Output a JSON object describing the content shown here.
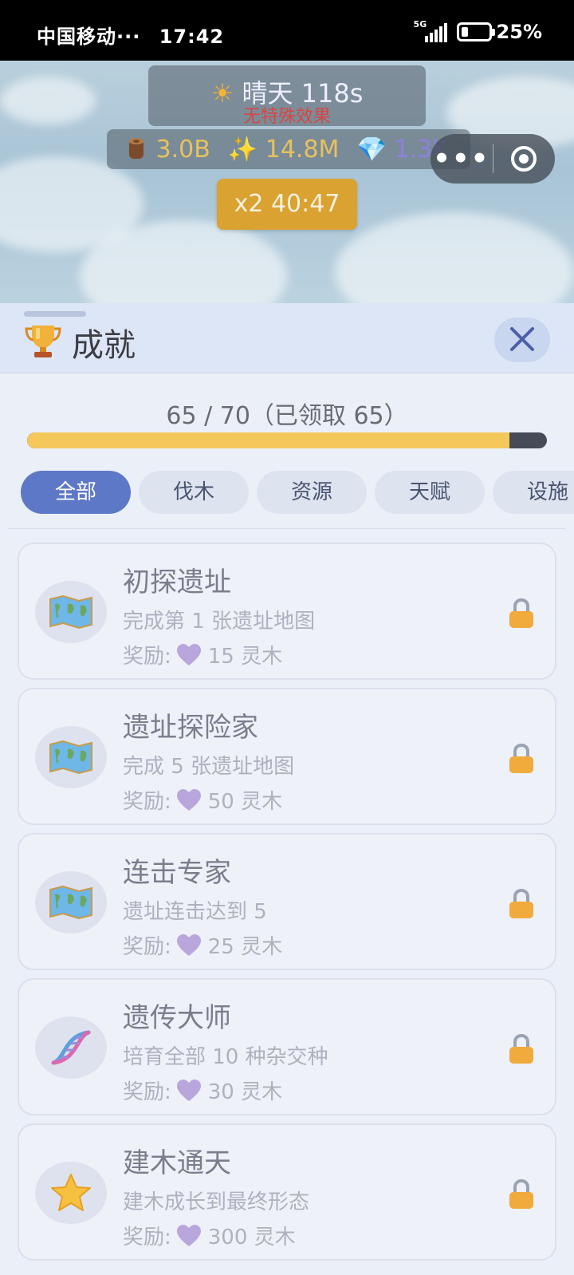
{
  "status_bar": {
    "carrier": "中国移动···",
    "time": "17:42",
    "network": "5G",
    "battery": "25%",
    "battery_level": 0.25
  },
  "game": {
    "weather_label": "晴天",
    "weather_timer": "118s",
    "weather_effect": "无特殊效果",
    "wood": "3.0B",
    "sparkle": "14.8M",
    "gems": "1.3K",
    "boost": "x2 40:47"
  },
  "panel": {
    "title": "成就",
    "progress_text": "65 / 70（已领取 65）",
    "progress_fraction": 0.9286,
    "tabs": [
      {
        "label": "全部",
        "active": true
      },
      {
        "label": "伐木",
        "active": false
      },
      {
        "label": "资源",
        "active": false
      },
      {
        "label": "天赋",
        "active": false
      },
      {
        "label": "设施",
        "active": false
      }
    ],
    "reward_prefix": "奖励:",
    "achievements": [
      {
        "name": "初探遗址",
        "desc": "完成第 1 张遗址地图",
        "reward": "15 灵木",
        "icon": "map-icon"
      },
      {
        "name": "遗址探险家",
        "desc": "完成 5 张遗址地图",
        "reward": "50 灵木",
        "icon": "map-icon"
      },
      {
        "name": "连击专家",
        "desc": "遗址连击达到 5",
        "reward": "25 灵木",
        "icon": "map-icon"
      },
      {
        "name": "遗传大师",
        "desc": "培育全部 10 种杂交种",
        "reward": "30 灵木",
        "icon": "dna-icon"
      },
      {
        "name": "建木通天",
        "desc": "建木成长到最终形态",
        "reward": "300 灵木",
        "icon": "star-icon"
      }
    ]
  }
}
